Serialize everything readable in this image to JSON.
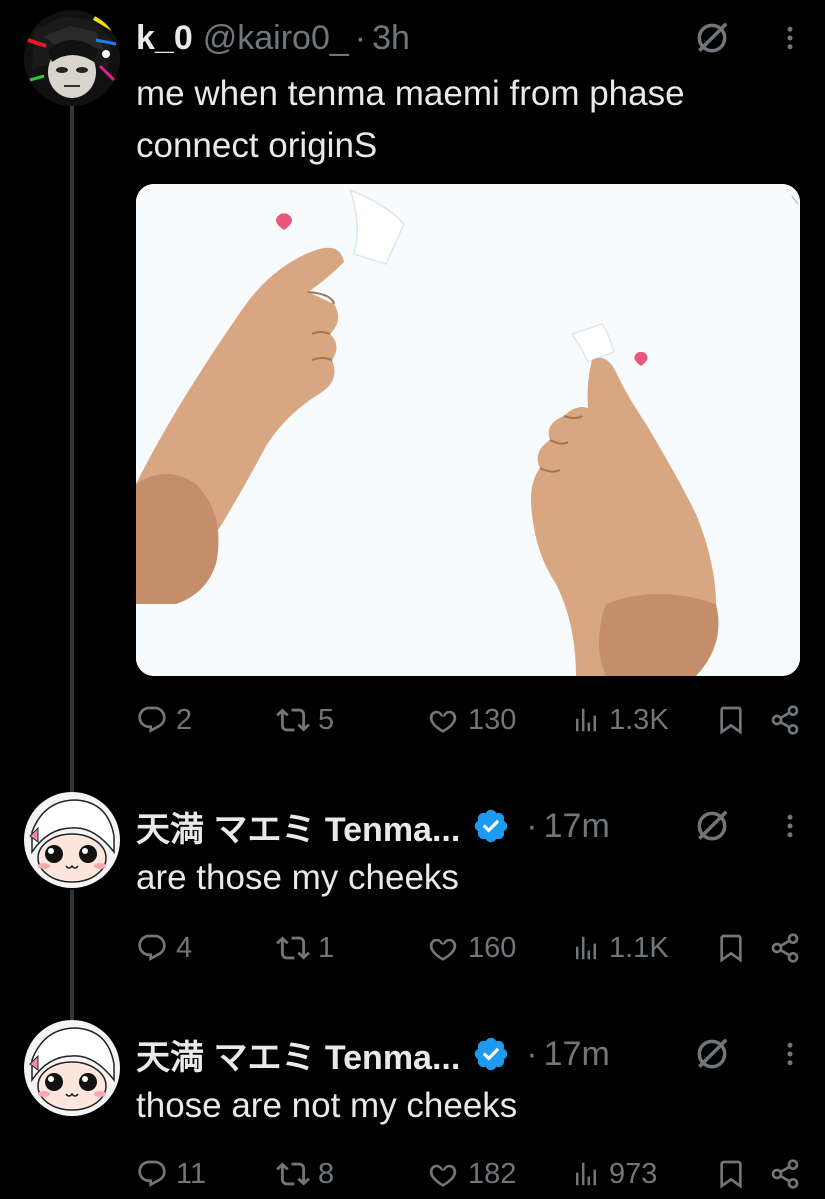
{
  "tweets": [
    {
      "name": "k_0",
      "handle": "@kairo0_",
      "time": "3h",
      "text_lines": [
        "me when tenma maemi from phase",
        "connect originS"
      ],
      "stats": {
        "replies": "2",
        "retweets": "5",
        "likes": "130",
        "views": "1.3K"
      },
      "avatar_icon": "avatar-anime-glitch"
    },
    {
      "name": "天満 マエミ Tenma...",
      "time": "17m",
      "verified": true,
      "text_lines": [
        "are those my cheeks"
      ],
      "stats": {
        "replies": "4",
        "retweets": "1",
        "likes": "160",
        "views": "1.1K"
      },
      "avatar_icon": "avatar-chibi"
    },
    {
      "name": "天満 マエミ Tenma...",
      "time": "17m",
      "verified": true,
      "text_lines": [
        "those are not my cheeks"
      ],
      "stats": {
        "replies": "11",
        "retweets": "8",
        "likes": "182",
        "views": "973"
      },
      "avatar_icon": "avatar-chibi"
    }
  ],
  "separator": "·",
  "colors": {
    "background": "#000000",
    "text": "#e7e9ea",
    "muted": "#71767b",
    "verified": "#1d9bf0",
    "thread_line": "#333639"
  }
}
